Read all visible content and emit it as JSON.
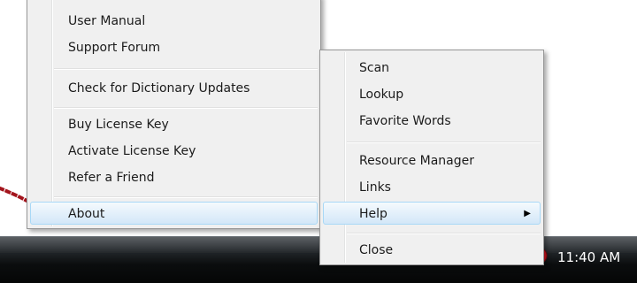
{
  "main_menu": {
    "items": [
      {
        "label": "User Manual"
      },
      {
        "label": "Support Forum"
      },
      {
        "label": "Check for Dictionary Updates"
      },
      {
        "label": "Buy License Key"
      },
      {
        "label": "Activate License Key"
      },
      {
        "label": "Refer a Friend"
      },
      {
        "label": "About"
      }
    ]
  },
  "sub_menu": {
    "items": [
      {
        "label": "Scan"
      },
      {
        "label": "Lookup"
      },
      {
        "label": "Favorite Words"
      },
      {
        "label": "Resource Manager"
      },
      {
        "label": "Links"
      },
      {
        "label": "Help"
      },
      {
        "label": "Close"
      }
    ]
  },
  "taskbar": {
    "clock": "11:40 AM",
    "chevron_icon": "chevron-left-icon",
    "app_icon": "red-info-icon"
  },
  "colors": {
    "highlight": "#d3e7f8",
    "menu_bg": "#f0f0f0",
    "pointer": "#a3141c",
    "tray_icon": "#d9141f"
  }
}
